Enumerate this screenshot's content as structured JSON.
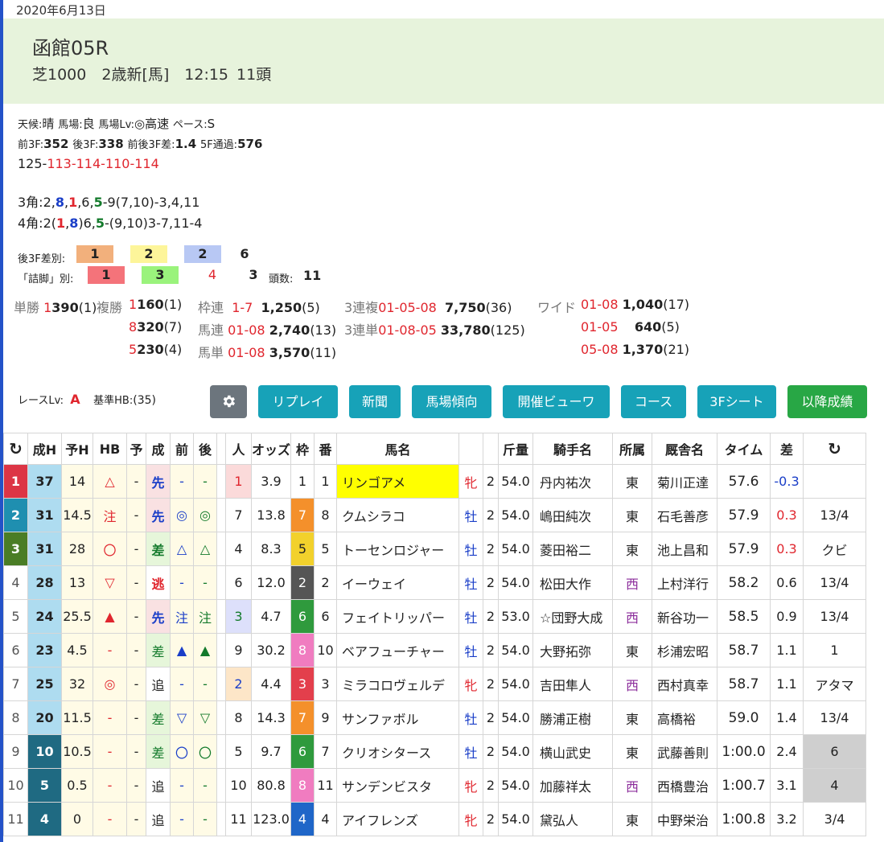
{
  "date": "2020年6月13日",
  "race": {
    "venue": "函館05R",
    "sub": "芝1000　2歳新[馬]　12:15 11頭"
  },
  "cond": {
    "weather_l": "天候:",
    "weather_v": "晴",
    "track_l": "馬場:",
    "track_v": "良",
    "lv_l": "馬場Lv:",
    "lv_v": "◎高速",
    "pace_l": "ペース:",
    "pace_v": "S"
  },
  "split": {
    "f3_l": "前3F:",
    "f3_v": "352",
    "l3_l": "後3F:",
    "l3_v": "338",
    "d_l": "前後3F差:",
    "d_v": "1.4",
    "f5_l": "5F通過:",
    "f5_v": "576"
  },
  "laps": {
    "first": "125-",
    "rest": "113-114-110-114"
  },
  "corner3": {
    "a": "3角:2,",
    "b": "8",
    "c": ",",
    "d": "1",
    "e": ",6,",
    "f": "5",
    "g": "-9(7,10)-3,4,11"
  },
  "corner4": {
    "a": "4角:2(",
    "b": "1",
    "c": ",",
    "d": "8",
    "e": ")6,",
    "f": "5",
    "g": "-(9,10)3-7,11-4"
  },
  "back3f": {
    "label": "後3F差別:",
    "v1": "1",
    "v2": "2",
    "v3": "2",
    "v4": "6"
  },
  "tsume": {
    "label": "「詰脚」別:",
    "v1": "1",
    "v2": "3",
    "v3": "4",
    "v4": "3",
    "head_l": "頭数:",
    "head_v": "11"
  },
  "pay": {
    "tansho_l": "単勝",
    "tansho_n": "1",
    "tansho_v": "390",
    "tansho_r": "(1)",
    "fuku_l": "複勝",
    "fuku": [
      {
        "n": "1",
        "v": "160",
        "r": "(1)"
      },
      {
        "n": "8",
        "v": "320",
        "r": "(7)"
      },
      {
        "n": "5",
        "v": "230",
        "r": "(4)"
      }
    ],
    "waku_l": "枠連",
    "waku_n": "1-7",
    "waku_v": "1,250",
    "waku_r": "(5)",
    "umaren_l": "馬連",
    "umaren_n": "01-08",
    "umaren_v": "2,740",
    "umaren_r": "(13)",
    "umatan_l": "馬単",
    "umatan_n": "01-08",
    "umatan_v": "3,570",
    "umatan_r": "(11)",
    "sanfuku_l": "3連複",
    "sanfuku_n": "01-05-08",
    "sanfuku_v": "7,750",
    "sanfuku_r": "(36)",
    "santan_l": "3連単",
    "santan_n": "01-08-05",
    "santan_v": "33,780",
    "santan_r": "(125)",
    "wide_l": "ワイド",
    "wide": [
      {
        "n": "01-08",
        "v": "1,040",
        "r": "(17)"
      },
      {
        "n": "01-05",
        "v": "640",
        "r": "(5)"
      },
      {
        "n": "05-08",
        "v": "1,370",
        "r": "(21)"
      }
    ]
  },
  "racelv": {
    "label": "レースLv:",
    "value": "A",
    "hb_l": "基準HB:",
    "hb_v": "(35)"
  },
  "buttons": {
    "replay": "リプレイ",
    "news": "新聞",
    "track": "馬場傾向",
    "viewer": "開催ビューワ",
    "course": "コース",
    "sheet": "3Fシート",
    "after": "以降成績"
  },
  "headers": [
    "成H",
    "予H",
    "HB",
    "予",
    "成",
    "前",
    "後",
    "人",
    "オッズ",
    "枠",
    "番",
    "馬名",
    "",
    "",
    "斤量",
    "騎手名",
    "所属",
    "厩舎名",
    "タイム",
    "差"
  ],
  "rows": [
    {
      "rank": "1",
      "h": "37",
      "yh": "14",
      "hb": "△",
      "y": "-",
      "sei": "先",
      "mae": "-",
      "ato": "-",
      "pop": "1",
      "odds": "3.9",
      "waku": "1",
      "ban": "1",
      "name": "リンゴアメ",
      "sex": "牝",
      "age": "2",
      "kin": "54.0",
      "jockey": "丹内祐次",
      "shozoku": "東",
      "trainer": "菊川正達",
      "time": "57.6",
      "diff": "-0.3",
      "chaku": ""
    },
    {
      "rank": "2",
      "h": "31",
      "yh": "14.5",
      "hb": "注",
      "y": "-",
      "sei": "先",
      "mae": "◎",
      "ato": "◎",
      "pop": "7",
      "odds": "13.8",
      "waku": "7",
      "ban": "8",
      "name": "クムシラコ",
      "sex": "牡",
      "age": "2",
      "kin": "54.0",
      "jockey": "嶋田純次",
      "shozoku": "東",
      "trainer": "石毛善彦",
      "time": "57.9",
      "diff": "0.3",
      "chaku": "13/4"
    },
    {
      "rank": "3",
      "h": "31",
      "yh": "28",
      "hb": "〇",
      "y": "-",
      "sei": "差",
      "mae": "△",
      "ato": "△",
      "pop": "4",
      "odds": "8.3",
      "waku": "5",
      "ban": "5",
      "name": "トーセンロジャー",
      "sex": "牡",
      "age": "2",
      "kin": "54.0",
      "jockey": "菱田裕二",
      "shozoku": "東",
      "trainer": "池上昌和",
      "time": "57.9",
      "diff": "0.3",
      "chaku": "クビ"
    },
    {
      "rank": "4",
      "h": "28",
      "yh": "13",
      "hb": "▽",
      "y": "-",
      "sei": "逃",
      "mae": "-",
      "ato": "-",
      "pop": "6",
      "odds": "12.0",
      "waku": "2",
      "ban": "2",
      "name": "イーウェイ",
      "sex": "牡",
      "age": "2",
      "kin": "54.0",
      "jockey": "松田大作",
      "shozoku": "西",
      "trainer": "上村洋行",
      "time": "58.2",
      "diff": "0.6",
      "chaku": "13/4"
    },
    {
      "rank": "5",
      "h": "24",
      "yh": "25.5",
      "hb": "▲",
      "y": "-",
      "sei": "先",
      "mae": "注",
      "ato": "注",
      "pop": "3",
      "odds": "4.7",
      "waku": "6",
      "ban": "6",
      "name": "フェイトリッパー",
      "sex": "牡",
      "age": "2",
      "kin": "53.0",
      "jockey": "☆団野大成",
      "shozoku": "西",
      "trainer": "新谷功一",
      "time": "58.5",
      "diff": "0.9",
      "chaku": "13/4"
    },
    {
      "rank": "6",
      "h": "23",
      "yh": "4.5",
      "hb": "-",
      "y": "-",
      "sei": "差",
      "mae": "▲",
      "ato": "▲",
      "pop": "9",
      "odds": "30.2",
      "waku": "8",
      "ban": "10",
      "name": "ベアフューチャー",
      "sex": "牡",
      "age": "2",
      "kin": "54.0",
      "jockey": "大野拓弥",
      "shozoku": "東",
      "trainer": "杉浦宏昭",
      "time": "58.7",
      "diff": "1.1",
      "chaku": "1"
    },
    {
      "rank": "7",
      "h": "25",
      "yh": "32",
      "hb": "◎",
      "y": "-",
      "sei": "追",
      "mae": "-",
      "ato": "-",
      "pop": "2",
      "odds": "4.4",
      "waku": "3",
      "ban": "3",
      "name": "ミラコロヴェルデ",
      "sex": "牝",
      "age": "2",
      "kin": "54.0",
      "jockey": "吉田隼人",
      "shozoku": "西",
      "trainer": "西村真幸",
      "time": "58.7",
      "diff": "1.1",
      "chaku": "アタマ"
    },
    {
      "rank": "8",
      "h": "20",
      "yh": "11.5",
      "hb": "-",
      "y": "-",
      "sei": "差",
      "mae": "▽",
      "ato": "▽",
      "pop": "8",
      "odds": "14.3",
      "waku": "7",
      "ban": "9",
      "name": "サンファボル",
      "sex": "牡",
      "age": "2",
      "kin": "54.0",
      "jockey": "勝浦正樹",
      "shozoku": "東",
      "trainer": "高橋裕",
      "time": "59.0",
      "diff": "1.4",
      "chaku": "13/4"
    },
    {
      "rank": "9",
      "h": "10",
      "yh": "10.5",
      "hb": "-",
      "y": "-",
      "sei": "差",
      "mae": "〇",
      "ato": "〇",
      "pop": "5",
      "odds": "9.7",
      "waku": "6",
      "ban": "7",
      "name": "クリオシタース",
      "sex": "牡",
      "age": "2",
      "kin": "54.0",
      "jockey": "横山武史",
      "shozoku": "東",
      "trainer": "武藤善則",
      "time": "1:00.0",
      "diff": "2.4",
      "chaku": "6"
    },
    {
      "rank": "10",
      "h": "5",
      "yh": "0.5",
      "hb": "-",
      "y": "-",
      "sei": "追",
      "mae": "-",
      "ato": "-",
      "pop": "10",
      "odds": "80.8",
      "waku": "8",
      "ban": "11",
      "name": "サンデンビスタ",
      "sex": "牝",
      "age": "2",
      "kin": "54.0",
      "jockey": "加藤祥太",
      "shozoku": "西",
      "trainer": "西橋豊治",
      "time": "1:00.7",
      "diff": "3.1",
      "chaku": "4"
    },
    {
      "rank": "11",
      "h": "4",
      "yh": "0",
      "hb": "-",
      "y": "-",
      "sei": "追",
      "mae": "-",
      "ato": "-",
      "pop": "11",
      "odds": "123.0",
      "waku": "4",
      "ban": "4",
      "name": "アイフレンズ",
      "sex": "牝",
      "age": "2",
      "kin": "54.0",
      "jockey": "黛弘人",
      "shozoku": "東",
      "trainer": "中野栄治",
      "time": "1:00.8",
      "diff": "3.2",
      "chaku": "3/4"
    }
  ],
  "colors": {
    "header_bg": "#e7f3dc",
    "btn_cyan": "#17a2b8",
    "btn_gray": "#6c757d",
    "btn_green": "#28a745",
    "name_highlight": "#ffff00"
  }
}
